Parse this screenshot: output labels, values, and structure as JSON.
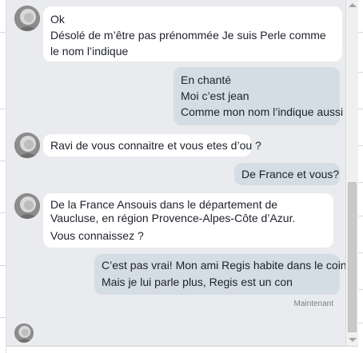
{
  "messages": [
    {
      "sender": "Perle",
      "direction": "in",
      "lines": [
        "Ok",
        "Désolé de m’être pas prénommée Je suis Perle comme le nom l’indique"
      ]
    },
    {
      "sender": "me",
      "direction": "out",
      "lines": [
        "En chanté",
        "Moi c’est jean",
        "Comme mon nom l’indique aussi"
      ]
    },
    {
      "sender": "Perle",
      "direction": "in",
      "lines": [
        "Ravi de vous connaitre et vous etes d’ou ?"
      ]
    },
    {
      "sender": "me",
      "direction": "out",
      "lines": [
        "De France et vous?"
      ]
    },
    {
      "sender": "Perle",
      "direction": "in",
      "lines": [
        "De la France Ansouis dans le département de Vaucluse, en région Provence-Alpes-Côte d’Azur.",
        "Vous connaissez ?"
      ]
    },
    {
      "sender": "me",
      "direction": "out",
      "lines": [
        "C’est pas vrai! Mon ami Regis habite dans le coin!",
        "Mais je lui parle plus, Regis est un con"
      ]
    }
  ],
  "timestamp": "Maintenant",
  "colors": {
    "incoming_bubble": "#ffffff",
    "outgoing_bubble": "#d4dde3",
    "background": "#e9ebee"
  }
}
